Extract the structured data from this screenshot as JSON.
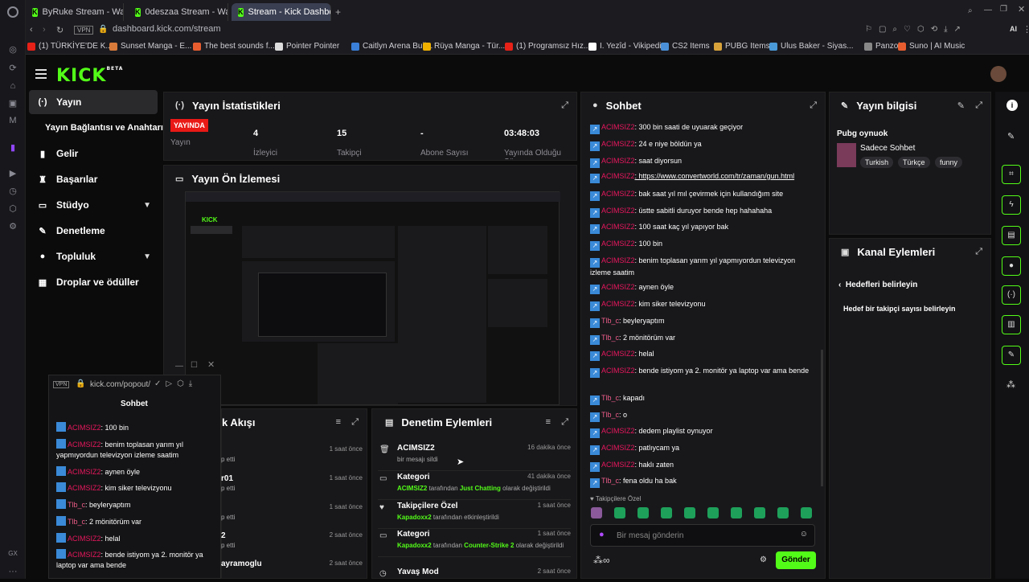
{
  "browser": {
    "tabs": [
      {
        "label": "ByRuke Stream - Watc"
      },
      {
        "label": "0deszaa Stream - Watch L"
      },
      {
        "label": "Stream - Kick Dashbo"
      }
    ],
    "url": "dashboard.kick.com/stream",
    "vpn": "VPN",
    "bookmarks": [
      {
        "label": "(1) TÜRKİYE'DE K...",
        "color": "#e62117"
      },
      {
        "label": "Sunset Manga - E...",
        "color": "#d87a3a"
      },
      {
        "label": "The best sounds f...",
        "color": "#e85d2f"
      },
      {
        "label": "Pointer Pointer",
        "color": "#dddddd"
      },
      {
        "label": "Caitlyn Arena Buil...",
        "color": "#3a7fd8"
      },
      {
        "label": "Rüya Manga - Tür...",
        "color": "#f0b000"
      },
      {
        "label": "(1) Programsız Hız...",
        "color": "#e62117"
      },
      {
        "label": "I. Yezîd - Vikipedi",
        "color": "#ffffff"
      },
      {
        "label": "CS2 Items",
        "color": "#4a90d8"
      },
      {
        "label": "PUBG Items",
        "color": "#d8a23a"
      },
      {
        "label": "Ulus Baker - Siyas...",
        "color": "#4a9ad8"
      },
      {
        "label": "Panzoid",
        "color": "#888888"
      },
      {
        "label": "Suno | AI Music",
        "color": "#e85d2f"
      }
    ]
  },
  "kick": {
    "logo": "KICK",
    "beta": "BETA"
  },
  "nav": [
    {
      "label": "Yayın",
      "icon": "broadcast-icon",
      "glyph": "(·)"
    },
    {
      "label": "Yayın Bağlantısı ve Anahtarı",
      "icon": "",
      "glyph": ""
    },
    {
      "label": "Gelir",
      "icon": "chart-icon",
      "glyph": "▮"
    },
    {
      "label": "Başarılar",
      "icon": "trophy-icon",
      "glyph": "🏆"
    },
    {
      "label": "Stüdyo",
      "icon": "studio-icon",
      "glyph": "▭"
    },
    {
      "label": "Denetleme",
      "icon": "wrench-icon",
      "glyph": "✎"
    },
    {
      "label": "Topluluk",
      "icon": "community-icon",
      "glyph": "●"
    },
    {
      "label": "Droplar ve ödüller",
      "icon": "gift-icon",
      "glyph": "▦"
    }
  ],
  "stats": {
    "title": "Yayın İstatistikleri",
    "live_badge": "YAYINDA",
    "items": [
      {
        "value": "",
        "label": "Yayın"
      },
      {
        "value": "4",
        "label": "İzleyici"
      },
      {
        "value": "15",
        "label": "Takipçi"
      },
      {
        "value": "-",
        "label": "Abone Sayısı"
      },
      {
        "value": "03:48:03",
        "label": "Yayında Olduğu Süre"
      }
    ]
  },
  "preview": {
    "title": "Yayın Ön İzlemesi"
  },
  "activity": {
    "title": "k Akışı",
    "rows": [
      {
        "time": "1 saat önce",
        "name": "",
        "desc": "p etti"
      },
      {
        "time": "1 saat önce",
        "name": "r01",
        "desc": "p etti"
      },
      {
        "time": "1 saat önce",
        "name": "",
        "desc": "p etti"
      },
      {
        "time": "2 saat önce",
        "name": "2",
        "desc": "p etti"
      },
      {
        "time": "2 saat önce",
        "name": "ayramoglu",
        "desc": ""
      }
    ]
  },
  "moderation": {
    "title": "Denetim Eylemleri",
    "rows": [
      {
        "title": "ACIMSIZ2",
        "time": "16 dakika önce",
        "desc": "bir mesajı sildi"
      },
      {
        "title": "Kategori",
        "time": "41 dakika önce",
        "desc_a": "ACIMSIZ2",
        "desc_b": " tarafından ",
        "desc_c": "Just Chatting",
        "desc_d": " olarak değiştirildi"
      },
      {
        "title": "Takipçilere Özel",
        "time": "1 saat önce",
        "desc_a": "Kapadoxx2",
        "desc_b": " tarafından etkinleştirildi"
      },
      {
        "title": "Kategori",
        "time": "1 saat önce",
        "desc_a": "Kapadoxx2",
        "desc_b": " tarafından ",
        "desc_c": "Counter-Strike 2",
        "desc_d": " olarak değiştirildi"
      },
      {
        "title": "Yavaş Mod",
        "time": "2 saat önce"
      }
    ]
  },
  "chat": {
    "title": "Sohbet",
    "messages": [
      {
        "user": "ACIMSIZ2",
        "text": ": 300 bin saati de uyuarak geçiyor",
        "c": "u1"
      },
      {
        "user": "ACIMSIZ2",
        "text": ": 24 e niye böldün ya",
        "c": "u1"
      },
      {
        "user": "ACIMSIZ2",
        "text": ": saat diyorsun",
        "c": "u1"
      },
      {
        "user": "ACIMSIZ2",
        "text": ": https://www.convertworld.com/tr/zaman/gun.html",
        "c": "u1"
      },
      {
        "user": "ACIMSIZ2",
        "text": ": bak saat yıl mıl çevirmek için kullandığım site",
        "c": "u1"
      },
      {
        "user": "ACIMSIZ2",
        "text": ": üstte sabitli duruyor bende hep hahahaha",
        "c": "u1"
      },
      {
        "user": "ACIMSIZ2",
        "text": ": 100 saat kaç yıl yapıyor bak",
        "c": "u1"
      },
      {
        "user": "ACIMSIZ2",
        "text": ": 100 bin",
        "c": "u1"
      },
      {
        "user": "ACIMSIZ2",
        "text": ": benim toplasan yarım yıl yapmıyordun televizyon izleme saatim",
        "c": "u1"
      },
      {
        "user": "ACIMSIZ2",
        "text": ": aynen öyle",
        "c": "u1"
      },
      {
        "user": "ACIMSIZ2",
        "text": ": kim siker televizyonu",
        "c": "u1"
      },
      {
        "user": "Tlb_c",
        "text": ": beyleryaptım",
        "c": "u2"
      },
      {
        "user": "Tlb_c",
        "text": ": 2 mönitörüm var",
        "c": "u2"
      },
      {
        "user": "ACIMSIZ2",
        "text": ": helal",
        "c": "u1"
      },
      {
        "user": "ACIMSIZ2",
        "text": ": bende istiyom ya 2. monitör ya laptop var ama bende",
        "c": "u1"
      },
      {
        "user": "Tlb_c",
        "text": ": kapadı",
        "c": "u2"
      },
      {
        "user": "Tlb_c",
        "text": ": o",
        "c": "u2"
      },
      {
        "user": "ACIMSIZ2",
        "text": ": dedem playlist oynuyor",
        "c": "u1"
      },
      {
        "user": "ACIMSIZ2",
        "text": ": patlıycam ya",
        "c": "u1"
      },
      {
        "user": "ACIMSIZ2",
        "text": ": haklı zaten",
        "c": "u1"
      },
      {
        "user": "Tlb_c",
        "text": ": fena oldu ha bak",
        "c": "u2"
      }
    ],
    "followers_only": "Takipçilere Özel",
    "input_placeholder": "Bir mesaj gönderin",
    "send": "Gönder"
  },
  "stream_info": {
    "title": "Yayın bilgisi",
    "stream_title": "Pubg oynuok",
    "category": "Sadece Sohbet",
    "tags": [
      "Turkish",
      "Türkçe",
      "funny"
    ]
  },
  "channel_actions": {
    "title": "Kanal Eylemleri",
    "back": "Hedefleri belirleyin",
    "goal": "Hedef bir takipçi sayısı belirleyin"
  },
  "popout": {
    "url": "kick.com/popout/",
    "vpn": "VPN",
    "title": "Sohbet",
    "messages": [
      {
        "user": "ACIMSIZ2",
        "text": ": 100 bin",
        "c": "u1"
      },
      {
        "user": "ACIMSIZ2",
        "text": ": benim toplasan yarım yıl yapmıyordun televizyon izleme saatim",
        "c": "u1"
      },
      {
        "user": "ACIMSIZ2",
        "text": ": aynen öyle",
        "c": "u1"
      },
      {
        "user": "ACIMSIZ2",
        "text": ": kim siker televizyonu",
        "c": "u1"
      },
      {
        "user": "Tlb_c",
        "text": ": beyleryaptım",
        "c": "u2"
      },
      {
        "user": "Tlb_c",
        "text": ": 2 mönitörüm var",
        "c": "u2"
      },
      {
        "user": "ACIMSIZ2",
        "text": ": helal",
        "c": "u1"
      },
      {
        "user": "ACIMSIZ2",
        "text": ": bende istiyom ya 2. monitör ya laptop var ama bende",
        "c": "u1"
      }
    ]
  }
}
